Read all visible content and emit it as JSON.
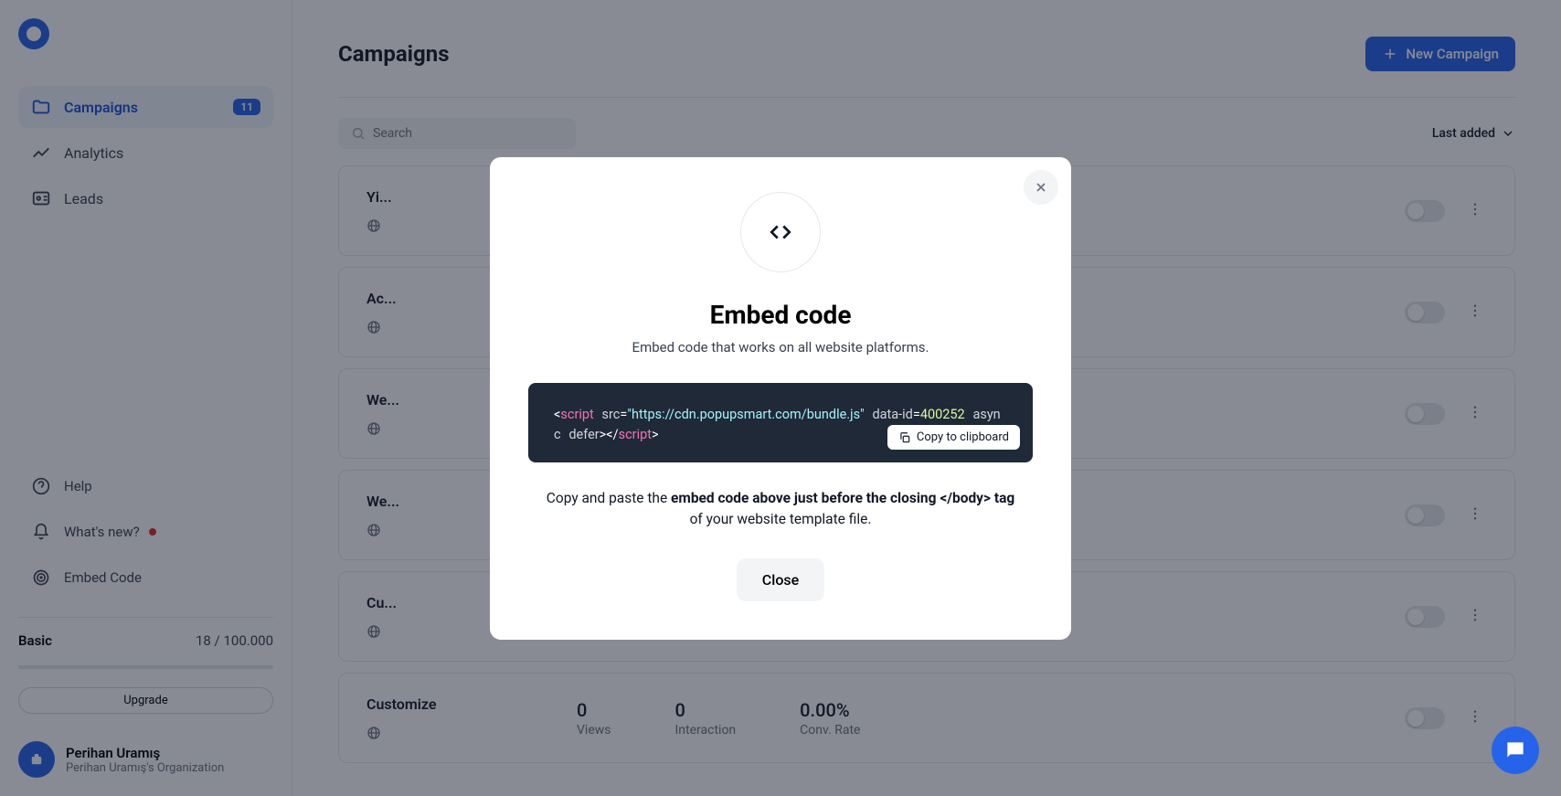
{
  "sidebar": {
    "nav": {
      "campaigns": "Campaigns",
      "campaigns_badge": "11",
      "analytics": "Analytics",
      "leads": "Leads"
    },
    "help": {
      "help": "Help",
      "whats_new": "What's new?",
      "embed_code": "Embed Code"
    },
    "plan": {
      "name": "Basic",
      "usage": "18 / 100.000",
      "upgrade": "Upgrade"
    },
    "user": {
      "name": "Perihan Uramış",
      "org": "Perihan Uramış's Organization"
    }
  },
  "header": {
    "title": "Campaigns",
    "new_btn": "New Campaign"
  },
  "toolbar": {
    "search_placeholder": "Search",
    "sort": "Last added"
  },
  "campaigns": [
    {
      "title": "Yi...",
      "views": "",
      "interaction": "",
      "rate": ""
    },
    {
      "title": "Ac...",
      "views": "",
      "interaction": "",
      "rate": ""
    },
    {
      "title": "We...",
      "views": "",
      "interaction": "",
      "rate": ""
    },
    {
      "title": "We...",
      "views": "",
      "interaction": "",
      "rate": ""
    },
    {
      "title": "Cu...",
      "views": "",
      "interaction": "",
      "rate": ""
    },
    {
      "title": "Customize",
      "views": "0",
      "interaction": "0",
      "rate": "0.00%"
    }
  ],
  "stat_labels": {
    "views": "Views",
    "interaction": "Interaction",
    "rate": "Conv. Rate"
  },
  "modal": {
    "title": "Embed code",
    "subtitle": "Embed code that works on all website platforms.",
    "code": {
      "tag": "script",
      "src_attr": "src",
      "src_val": "\"https://cdn.popupsmart.com/bundle.js\"",
      "data_attr": "data-id",
      "data_val": "400252",
      "async": "async",
      "defer": "defer"
    },
    "copy": "Copy to clipboard",
    "desc_prefix": "Copy and paste the ",
    "desc_bold": "embed code above just before the closing </body> tag ",
    "desc_suffix": "of your website template file.",
    "close": "Close"
  }
}
